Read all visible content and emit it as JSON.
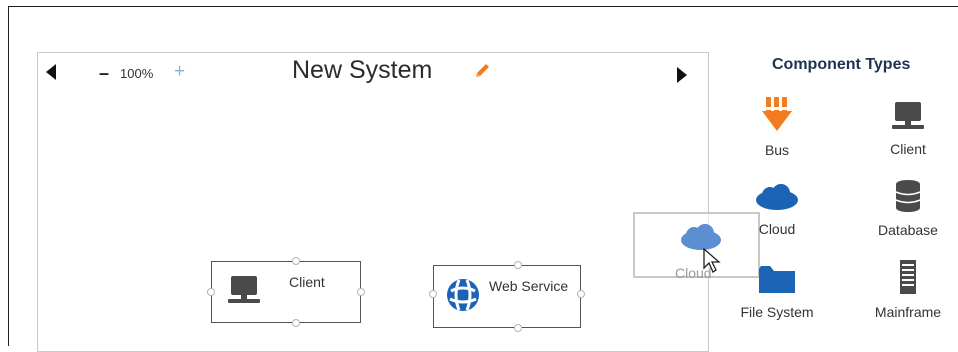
{
  "canvas": {
    "title": "New System",
    "zoom": {
      "minus": "–",
      "value": "100%",
      "plus": "+"
    }
  },
  "nodes": [
    {
      "label": "Client",
      "icon": "computer-icon"
    },
    {
      "label": "Web Service",
      "icon": "globe-icon"
    }
  ],
  "drag_ghost": {
    "label": "Cloud",
    "icon": "cloud-icon"
  },
  "palette": {
    "title": "Component Types",
    "items": [
      {
        "label": "Bus",
        "icon": "bus-icon",
        "color": "#f47b20"
      },
      {
        "label": "Client",
        "icon": "computer-icon",
        "color": "#4a4a4a"
      },
      {
        "label": "Cloud",
        "icon": "cloud-icon",
        "color": "#1b63b5"
      },
      {
        "label": "Database",
        "icon": "database-icon",
        "color": "#4a4a4a"
      },
      {
        "label": "File System",
        "icon": "folder-icon",
        "color": "#1b63b5"
      },
      {
        "label": "Mainframe",
        "icon": "mainframe-icon",
        "color": "#4a4a4a"
      }
    ]
  },
  "colors": {
    "accent_orange": "#f47b20",
    "accent_blue": "#1b63b5",
    "title_dark": "#1f3352",
    "zoom_plus": "#8eaed6"
  }
}
